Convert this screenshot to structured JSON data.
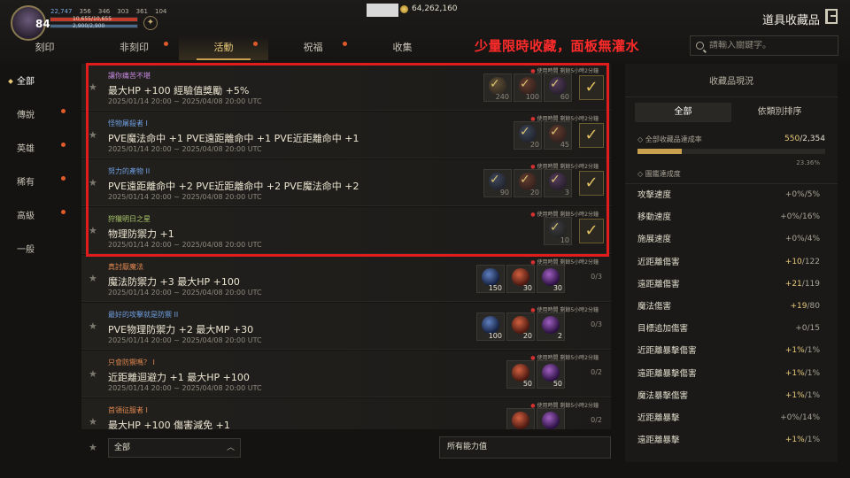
{
  "player": {
    "level": "84",
    "stats": [
      "22,747",
      "356",
      "346",
      "303",
      "361",
      "104"
    ],
    "hp_text": "10,655/10,655",
    "mp_text": "2,900/2,900",
    "hp_ratio": 1.0,
    "mp_ratio": 1.0
  },
  "currency": {
    "gold": "64,262,160"
  },
  "page_title": "道具收藏品",
  "tabs": [
    {
      "label": "刻印",
      "dot": false
    },
    {
      "label": "非刻印",
      "dot": true
    },
    {
      "label": "活動",
      "dot": true,
      "active": true
    },
    {
      "label": "祝福",
      "dot": true
    },
    {
      "label": "收集",
      "dot": false
    }
  ],
  "banner_text": "少量限時收藏，面板無灌水",
  "search": {
    "placeholder": "請輸入關鍵字。"
  },
  "sidebar": [
    {
      "label": "全部",
      "active": true,
      "dot": false
    },
    {
      "label": "傳說",
      "dot": true
    },
    {
      "label": "英雄",
      "dot": true
    },
    {
      "label": "稀有",
      "dot": true
    },
    {
      "label": "高級",
      "dot": true
    },
    {
      "label": "一般",
      "dot": false
    }
  ],
  "timer_text": "使用時間 剩餘5小時2分鐘",
  "items": [
    {
      "sub": "讓你痛苦不堪",
      "sub_color": "purple",
      "main": "最大HP +100 經驗值獎勵 +5%",
      "date": "2025/01/14 20:00 ~ 2025/04/08 20:00 UTC",
      "slots": [
        {
          "orb": "gold",
          "count": "240"
        },
        {
          "orb": "red",
          "count": "100"
        },
        {
          "orb": "purple",
          "count": "60"
        }
      ],
      "completed": true
    },
    {
      "sub": "怪物屠殺者 I",
      "sub_color": "blue",
      "main": "PVE魔法命中 +1 PVE遠距離命中 +1 PVE近距離命中 +1",
      "date": "2025/01/14 20:00 ~ 2025/04/08 20:00 UTC",
      "slots": [
        {
          "orb": "blue",
          "count": "20"
        },
        {
          "orb": "red",
          "count": "45"
        }
      ],
      "completed": true
    },
    {
      "sub": "努力的產物 II",
      "sub_color": "blue",
      "main": "PVE遠距離命中 +2 PVE近距離命中 +2 PVE魔法命中 +2",
      "date": "2025/01/14 20:00 ~ 2025/04/08 20:00 UTC",
      "slots": [
        {
          "orb": "blue",
          "count": "90"
        },
        {
          "orb": "red",
          "count": "20"
        },
        {
          "orb": "purple",
          "count": "3"
        }
      ],
      "completed": true
    },
    {
      "sub": "狩獵明日之星",
      "sub_color": "green",
      "main": "物理防禦力 +1",
      "date": "2025/01/14 20:00 ~ 2025/04/08 20:00 UTC",
      "slots": [
        {
          "orb": "dark",
          "count": "10"
        }
      ],
      "completed": true
    },
    {
      "sub": "真討厭魔法",
      "sub_color": "orange",
      "main": "魔法防禦力 +3 最大HP +100",
      "date": "2025/01/14 20:00 ~ 2025/04/08 20:00 UTC",
      "slots": [
        {
          "orb": "blue",
          "count": "150"
        },
        {
          "orb": "red",
          "count": "30"
        },
        {
          "orb": "purple",
          "count": "30"
        }
      ],
      "completed": false,
      "progress": "0/3"
    },
    {
      "sub": "最好的攻擊就是防禦 II",
      "sub_color": "blue",
      "main": "PVE物理防禦力 +2 最大MP +30",
      "date": "2025/01/14 20:00 ~ 2025/04/08 20:00 UTC",
      "slots": [
        {
          "orb": "blue",
          "count": "100"
        },
        {
          "orb": "red",
          "count": "20"
        },
        {
          "orb": "purple",
          "count": "2"
        }
      ],
      "completed": false,
      "progress": "0/3"
    },
    {
      "sub": "只會防禦嗎？ I",
      "sub_color": "orange",
      "main": "近距離迴避力 +1 最大HP +100",
      "date": "2025/01/14 20:00 ~ 2025/04/08 20:00 UTC",
      "slots": [
        {
          "orb": "red",
          "count": "50"
        },
        {
          "orb": "purple",
          "count": "50"
        }
      ],
      "completed": false,
      "progress": "0/2"
    },
    {
      "sub": "首領征服者 I",
      "sub_color": "orange",
      "main": "最大HP +100 傷害減免 +1",
      "date": "",
      "slots": [
        {
          "orb": "red",
          "count": ""
        },
        {
          "orb": "purple",
          "count": ""
        }
      ],
      "completed": false,
      "progress": "0/2"
    }
  ],
  "bottom": {
    "filter": "全部",
    "stat_filter": "所有能力值"
  },
  "panel": {
    "title": "收藏品現況",
    "tabs": [
      "全部",
      "依類別排序"
    ],
    "total_label": "全部收藏品達成率",
    "total_done": "550",
    "total_all": "/2,354",
    "total_ratio": 0.2336,
    "total_pct": "23.36%",
    "section_label": "圖鑑達成度",
    "stats": [
      {
        "name": "攻擊速度",
        "plus": "+0%",
        "max": "/5%",
        "hl": false
      },
      {
        "name": "移動速度",
        "plus": "+0%",
        "max": "/16%",
        "hl": false
      },
      {
        "name": "施展速度",
        "plus": "+0%",
        "max": "/4%",
        "hl": false
      },
      {
        "name": "近距離傷害",
        "plus": "+10",
        "max": "/122",
        "hl": true
      },
      {
        "name": "遠距離傷害",
        "plus": "+21",
        "max": "/119",
        "hl": true
      },
      {
        "name": "魔法傷害",
        "plus": "+19",
        "max": "/80",
        "hl": true
      },
      {
        "name": "目標追加傷害",
        "plus": "+0",
        "max": "/15",
        "hl": false
      },
      {
        "name": "近距離暴擊傷害",
        "plus": "+1%",
        "max": "/1%",
        "hl": true
      },
      {
        "name": "遠距離暴擊傷害",
        "plus": "+1%",
        "max": "/1%",
        "hl": true
      },
      {
        "name": "魔法暴擊傷害",
        "plus": "+1%",
        "max": "/1%",
        "hl": true
      },
      {
        "name": "近距離暴擊",
        "plus": "+0%",
        "max": "/14%",
        "hl": false
      },
      {
        "name": "遠距離暴擊",
        "plus": "+1%",
        "max": "/1%",
        "hl": true
      }
    ]
  }
}
